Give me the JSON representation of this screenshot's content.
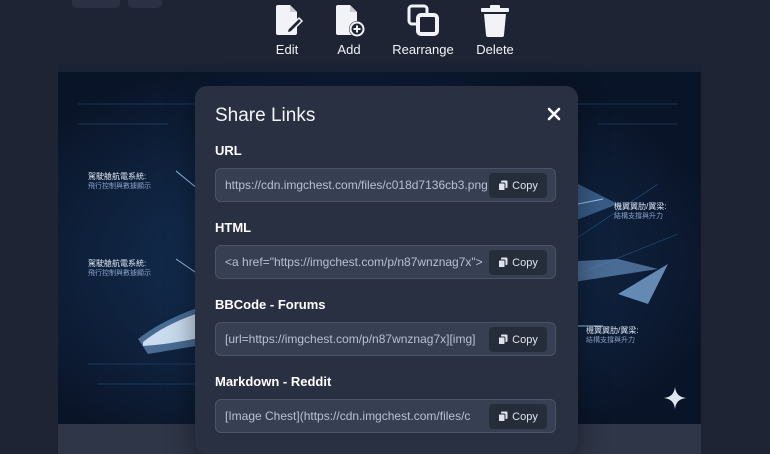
{
  "toolbar": {
    "items": [
      {
        "label": "Edit",
        "icon": "edit-file-icon"
      },
      {
        "label": "Add",
        "icon": "add-file-icon"
      },
      {
        "label": "Rearrange",
        "icon": "rearrange-icon"
      },
      {
        "label": "Delete",
        "icon": "trash-icon"
      }
    ]
  },
  "background_image": {
    "annotations": [
      {
        "title": "駕駛艙航電系統:",
        "sub": "飛行控制與數據顯示"
      },
      {
        "title": "駕駛艙航電系統:",
        "sub": "飛行控制與數據顯示"
      },
      {
        "title": "機翼翼肋/翼梁:",
        "sub": "結構支撐與升力"
      },
      {
        "title": "機翼翼肋/翼梁:",
        "sub": "結構支撐與升力"
      }
    ]
  },
  "modal": {
    "title": "Share Links",
    "fields": [
      {
        "label": "URL",
        "value": "https://cdn.imgchest.com/files/c018d7136cb3.png",
        "copy_label": "Copy"
      },
      {
        "label": "HTML",
        "value": "<a href=\"https://imgchest.com/p/n87wnznag7x\">",
        "copy_label": "Copy"
      },
      {
        "label": "BBCode - Forums",
        "value": "[url=https://imgchest.com/p/n87wnznag7x][img]",
        "copy_label": "Copy"
      },
      {
        "label": "Markdown - Reddit",
        "value": "[Image Chest](https://cdn.imgchest.com/files/c",
        "copy_label": "Copy"
      }
    ]
  },
  "colors": {
    "page_bg": "#1f2434",
    "modal_bg": "#283041",
    "field_bg": "#374053",
    "button_bg": "#252c3a",
    "image_bg": "#0a1428"
  }
}
